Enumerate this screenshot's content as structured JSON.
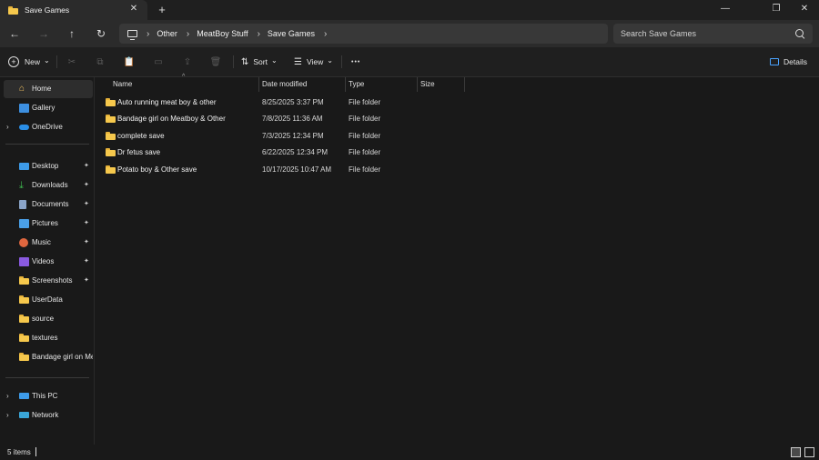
{
  "window": {
    "tab_title": "Save Games",
    "new_tab_label": "+",
    "minimize_label": "—",
    "maximize_label": "❐",
    "close_label": "✕",
    "tab_close_label": "✕"
  },
  "nav": {
    "back": "←",
    "forward": "→",
    "up": "↑",
    "refresh": "↻",
    "breadcrumbs": [
      "Other",
      "MeatBoy Stuff",
      "Save Games"
    ],
    "crumb_sep": "›",
    "search_placeholder": "Search Save Games"
  },
  "toolbar": {
    "new_label": "New",
    "sort_label": "Sort",
    "view_label": "View",
    "more_label": "•••",
    "details_label": "Details",
    "caret": "⌄"
  },
  "sidebar": {
    "home": "Home",
    "gallery": "Gallery",
    "onedrive": "OneDrive",
    "quick": [
      {
        "label": "Desktop",
        "icon": "desktop-icon",
        "pinned": true
      },
      {
        "label": "Downloads",
        "icon": "downloads-icon",
        "pinned": true
      },
      {
        "label": "Documents",
        "icon": "documents-icon",
        "pinned": true
      },
      {
        "label": "Pictures",
        "icon": "pictures-icon",
        "pinned": true
      },
      {
        "label": "Music",
        "icon": "music-icon",
        "pinned": true
      },
      {
        "label": "Videos",
        "icon": "videos-icon",
        "pinned": true
      },
      {
        "label": "Screenshots",
        "icon": "folder-icon",
        "pinned": true
      },
      {
        "label": "UserData",
        "icon": "folder-icon",
        "pinned": false
      },
      {
        "label": "source",
        "icon": "folder-icon",
        "pinned": false
      },
      {
        "label": "textures",
        "icon": "folder-icon",
        "pinned": false
      },
      {
        "label": "Bandage girl on Me",
        "icon": "folder-icon",
        "pinned": false
      }
    ],
    "this_pc": "This PC",
    "network": "Network",
    "chevron": "›",
    "pin_glyph": "📌"
  },
  "columns": {
    "name": "Name",
    "date": "Date modified",
    "type": "Type",
    "size": "Size",
    "sort_caret": "^"
  },
  "files": [
    {
      "name": "Auto running meat boy & other",
      "date": "8/25/2025 3:37 PM",
      "type": "File folder"
    },
    {
      "name": "Bandage girl on Meatboy & Other",
      "date": "7/8/2025 11:36 AM",
      "type": "File folder"
    },
    {
      "name": "complete save",
      "date": "7/3/2025 12:34 PM",
      "type": "File folder"
    },
    {
      "name": "Dr fetus save",
      "date": "6/22/2025 12:34 PM",
      "type": "File folder"
    },
    {
      "name": "Potato boy & Other save",
      "date": "10/17/2025 10:47 AM",
      "type": "File folder"
    }
  ],
  "status": {
    "count": "5 items"
  },
  "colors": {
    "folder": "#f6c84c",
    "background": "#191919",
    "bar": "#2b2b2b"
  }
}
